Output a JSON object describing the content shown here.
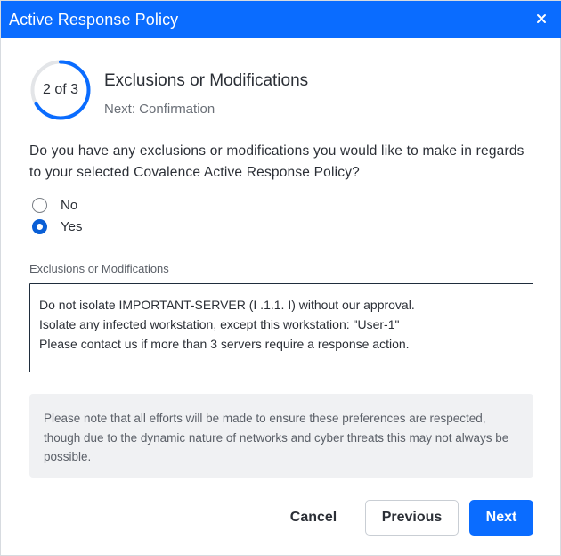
{
  "dialog": {
    "title": "Active Response Policy",
    "close_icon": "close-icon"
  },
  "colors": {
    "accent": "#0a6cff",
    "progress_track": "#e3e5e8",
    "note_bg": "#f0f1f3"
  },
  "stepper": {
    "progress_text": "2 of 3",
    "current_step": 2,
    "total_steps": 3,
    "step_title": "Exclusions or Modifications",
    "next_step": "Next: Confirmation"
  },
  "question": "Do you have any exclusions or modifications you would like to make in regards to your selected Covalence Active Response Policy?",
  "options": [
    {
      "label": "No",
      "selected": false
    },
    {
      "label": "Yes",
      "selected": true
    }
  ],
  "field": {
    "label": "Exclusions or Modifications",
    "lines": [
      "Do not isolate IMPORTANT-SERVER (I .1.1. I) without our approval.",
      "Isolate any infected workstation, except this workstation: \"User-1\"",
      "Please contact us if more than 3 servers require a response action."
    ]
  },
  "note": "Please note that all efforts will be made to ensure these preferences are respected, though due to the dynamic nature of networks and cyber threats this may not always be possible.",
  "buttons": {
    "cancel": "Cancel",
    "previous": "Previous",
    "next": "Next"
  }
}
